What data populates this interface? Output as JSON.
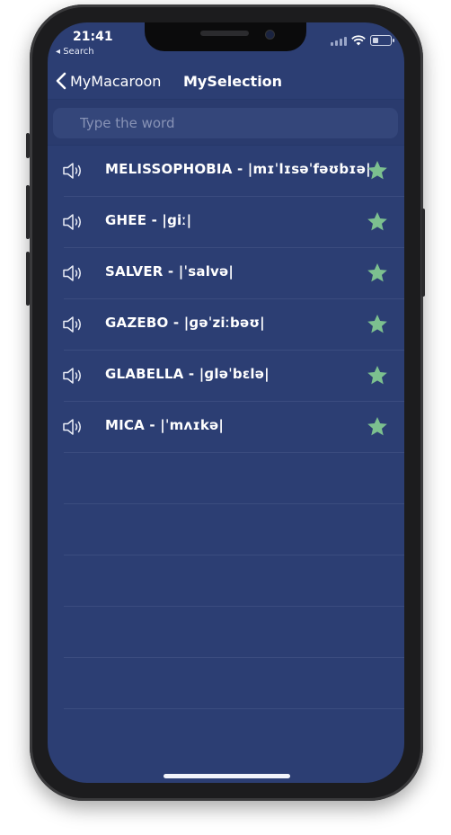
{
  "status_bar": {
    "time": "21:41",
    "back_label": "◂ Search"
  },
  "navbar": {
    "back_label": "MyMacaroon",
    "title": "MySelection"
  },
  "search": {
    "placeholder": "Type the word"
  },
  "words": [
    {
      "text": "MELISSOPHOBIA - |mɪˈlɪsəˈfəʊbɪə|",
      "starred": true
    },
    {
      "text": "GHEE - |giː|",
      "starred": true
    },
    {
      "text": "SALVER - |ˈsalvə|",
      "starred": true
    },
    {
      "text": "GAZEBO  - |ɡəˈziːbəʊ|",
      "starred": true
    },
    {
      "text": "GLABELLA - |ɡləˈbɛlə|",
      "starred": true
    },
    {
      "text": "MICA  - |ˈmʌɪkə|",
      "starred": true
    }
  ],
  "colors": {
    "background": "#2c3e73",
    "star": "#7cc08f",
    "text": "#ffffff"
  }
}
